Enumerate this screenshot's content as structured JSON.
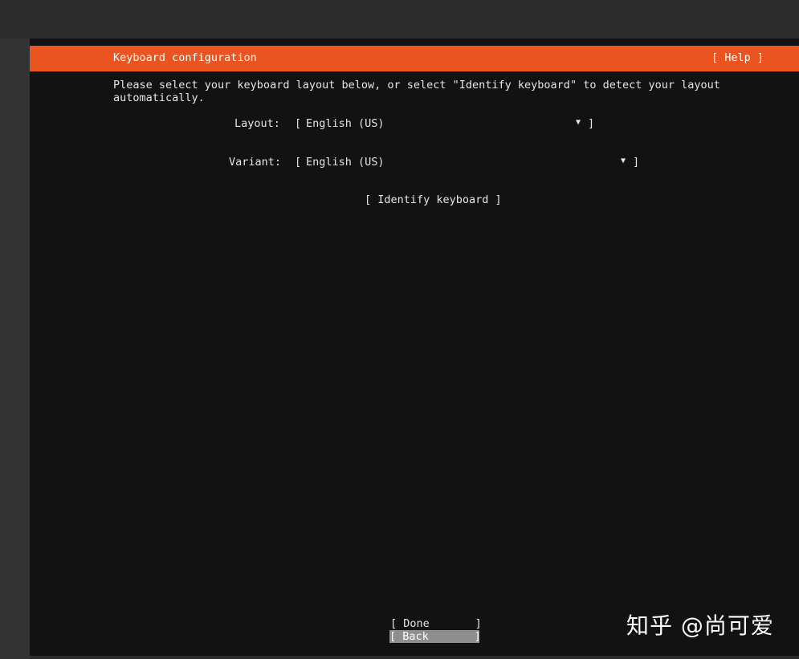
{
  "header": {
    "title": "Keyboard configuration",
    "help_label": "[ Help ]"
  },
  "description": "Please select your keyboard layout below, or select \"Identify keyboard\" to detect your layout\nautomatically.",
  "layout": {
    "label": "Layout:",
    "value": "English (US)",
    "open_bracket": "[",
    "close_bracket": "]",
    "arrow": "▼"
  },
  "variant": {
    "label": "Variant:",
    "value": "English (US)",
    "open_bracket": "[",
    "close_bracket": "]",
    "arrow": "▼"
  },
  "identify_label": "[ Identify keyboard ]",
  "footer": {
    "done_label": "[ Done       ]",
    "back_label": "[ Back       ]"
  },
  "watermark": "知乎 @尚可爱",
  "colors": {
    "accent": "#e95420",
    "background": "#121212",
    "selected": "#8e8e8e"
  }
}
